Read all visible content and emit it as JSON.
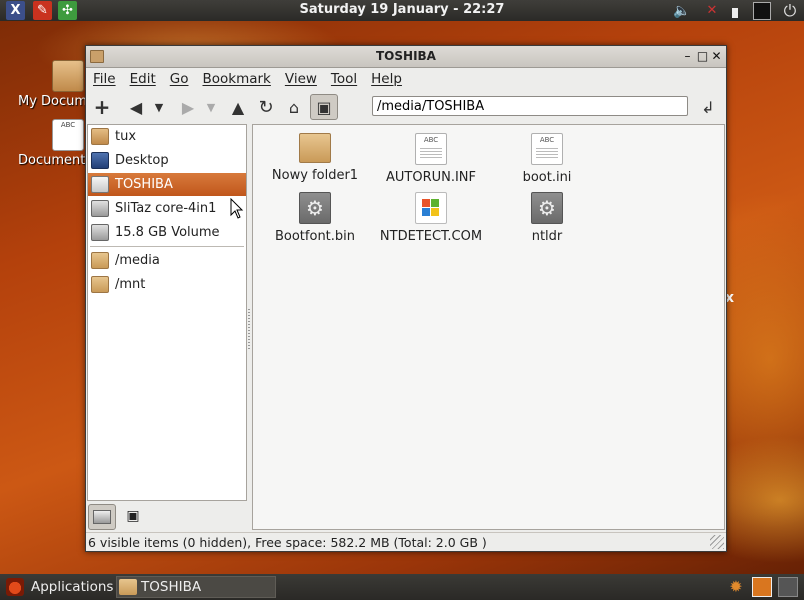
{
  "top_panel": {
    "clock": "Saturday 19 January - 22:27",
    "launchers": [
      {
        "name": "x-launcher-icon",
        "glyph": "X",
        "color": "#3c4f8a"
      },
      {
        "name": "tools-launcher-icon",
        "glyph": "✎",
        "color": "#c9321f"
      },
      {
        "name": "network-launcher-icon",
        "glyph": "✣",
        "color": "#3e9b3e"
      }
    ],
    "tray": [
      "volume-icon",
      "network-disabled-icon",
      "battery-icon",
      "terminal-icon",
      "power-icon"
    ]
  },
  "desktop": {
    "icons": [
      {
        "label": "My Docum",
        "icon": "home-folder-icon"
      },
      {
        "label": "Document",
        "icon": "text-document-icon"
      }
    ],
    "stray_glyph": "x"
  },
  "window": {
    "title": "TOSHIBA",
    "controls": {
      "minimize": "–",
      "maximize": "□",
      "close": "✕"
    },
    "menu": [
      "File",
      "Edit",
      "Go",
      "Bookmark",
      "View",
      "Tool",
      "Help"
    ],
    "toolbar": {
      "buttons": [
        "new-tab",
        "back",
        "back-history",
        "forward",
        "forward-history",
        "up",
        "reload",
        "home",
        "toggle-sidebar"
      ],
      "path": "/media/TOSHIBA"
    },
    "sidebar": {
      "places": [
        {
          "label": "tux",
          "icon": "home",
          "selected": false
        },
        {
          "label": "Desktop",
          "icon": "desk",
          "selected": false
        },
        {
          "label": "TOSHIBA",
          "icon": "usb",
          "selected": true
        },
        {
          "label": "SliTaz core-4in1",
          "icon": "drive",
          "selected": false
        },
        {
          "label": "15.8 GB Volume",
          "icon": "drive",
          "selected": false
        }
      ],
      "bookmarks": [
        {
          "label": "/media",
          "icon": "folder"
        },
        {
          "label": "/mnt",
          "icon": "folder"
        }
      ]
    },
    "files": [
      {
        "name": "Nowy folder1",
        "type": "folder"
      },
      {
        "name": "AUTORUN.INF",
        "type": "doc"
      },
      {
        "name": "boot.ini",
        "type": "doc"
      },
      {
        "name": "Bootfont.bin",
        "type": "gear"
      },
      {
        "name": "NTDETECT.COM",
        "type": "win"
      },
      {
        "name": "ntldr",
        "type": "gear"
      }
    ],
    "status": "6 visible items (0 hidden), Free space: 582.2 MB (Total: 2.0 GB )"
  },
  "bottom_panel": {
    "applications": "Applications",
    "task": "TOSHIBA"
  }
}
